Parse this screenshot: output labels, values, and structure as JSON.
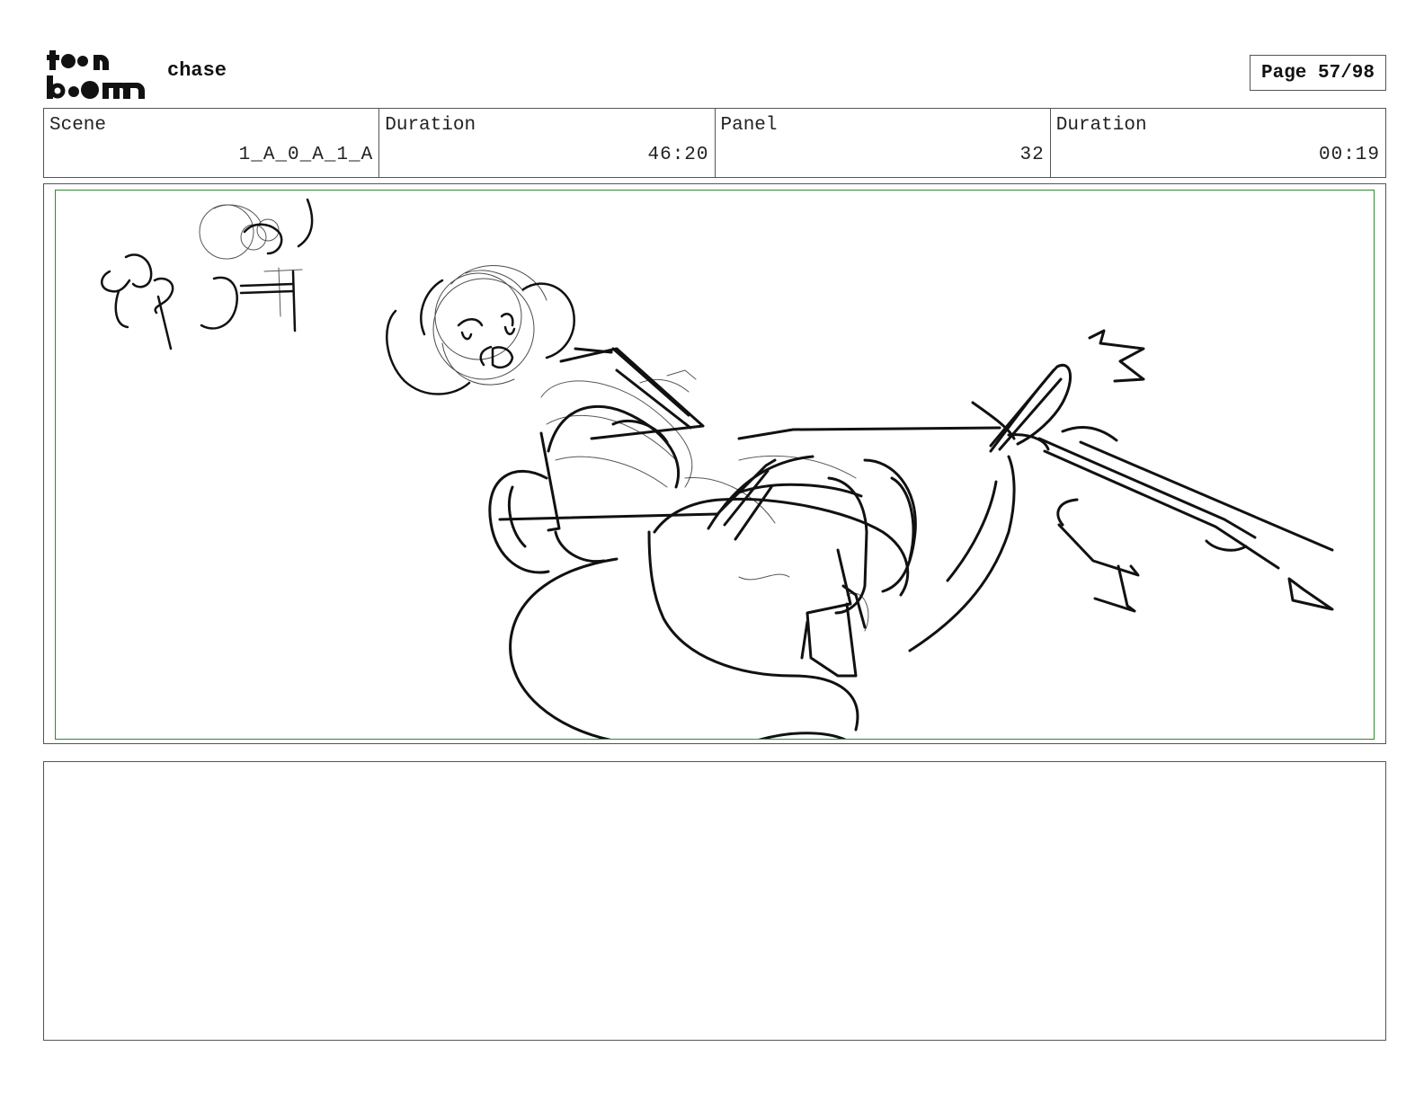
{
  "header": {
    "logo_text_top": "toon",
    "logo_text_bottom": "boom",
    "project_title": "chase",
    "page_label": "Page 57/98"
  },
  "info": {
    "scene_label": "Scene",
    "scene_value": "1_A_0_A_1_A",
    "duration_label": "Duration",
    "duration_value": "46:20",
    "panel_label": "Panel",
    "panel_value": "32",
    "panel_duration_label": "Duration",
    "panel_duration_value": "00:19"
  },
  "colors": {
    "safe_area_border": "#2e8b2e",
    "sketch_stroke": "#111111"
  },
  "notes": {
    "text": ""
  }
}
